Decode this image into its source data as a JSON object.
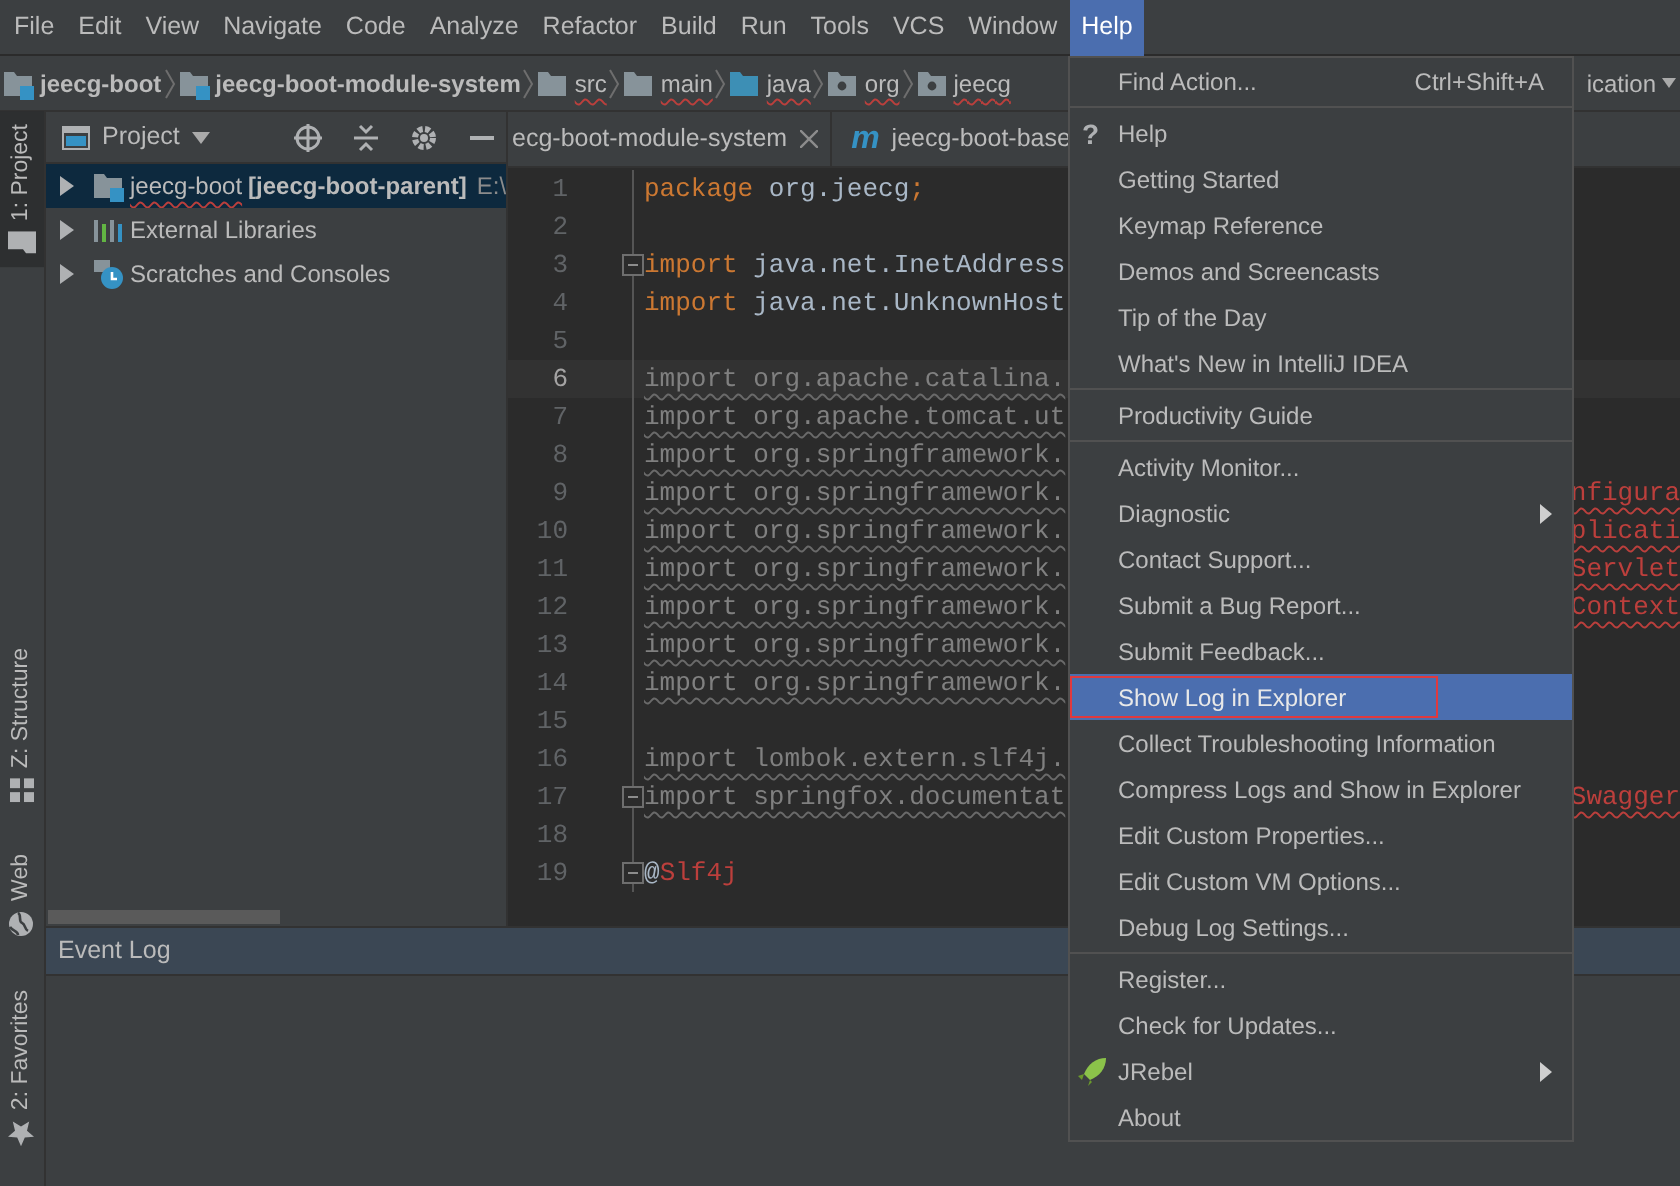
{
  "menu_bar": [
    {
      "label": "File",
      "selected": false
    },
    {
      "label": "Edit",
      "selected": false
    },
    {
      "label": "View",
      "selected": false
    },
    {
      "label": "Navigate",
      "selected": false
    },
    {
      "label": "Code",
      "selected": false
    },
    {
      "label": "Analyze",
      "selected": false
    },
    {
      "label": "Refactor",
      "selected": false
    },
    {
      "label": "Build",
      "selected": false
    },
    {
      "label": "Run",
      "selected": false
    },
    {
      "label": "Tools",
      "selected": false
    },
    {
      "label": "VCS",
      "selected": false
    },
    {
      "label": "Window",
      "selected": false
    },
    {
      "label": "Help",
      "selected": true
    }
  ],
  "breadcrumbs": [
    {
      "label": "jeecg-boot",
      "kind": "module",
      "misspelled": false
    },
    {
      "label": "jeecg-boot-module-system",
      "kind": "module",
      "misspelled": false
    },
    {
      "label": "src",
      "kind": "folder",
      "misspelled": true
    },
    {
      "label": "main",
      "kind": "folder",
      "misspelled": true
    },
    {
      "label": "java",
      "kind": "source",
      "misspelled": true
    },
    {
      "label": "org",
      "kind": "package",
      "misspelled": true
    },
    {
      "label": "jeecg",
      "kind": "package",
      "misspelled": true
    }
  ],
  "run_config": {
    "label": "ication"
  },
  "tool_strip": {
    "top": [
      {
        "label": "1: Project",
        "kind": "project",
        "selected": true
      }
    ],
    "bottom": [
      {
        "label": "Z: Structure",
        "kind": "structure",
        "selected": false
      },
      {
        "label": "Web",
        "kind": "web",
        "selected": false
      },
      {
        "label": "2: Favorites",
        "kind": "favorites",
        "selected": false
      }
    ]
  },
  "project_panel": {
    "title": "Project",
    "tree": [
      {
        "label": "jeecg-boot",
        "qualifier": "[jeecg-boot-parent]",
        "path": "E:\\",
        "kind": "module",
        "expanded": false,
        "selected": true
      },
      {
        "label": "External Libraries",
        "kind": "libraries",
        "expanded": false,
        "selected": false
      },
      {
        "label": "Scratches and Consoles",
        "kind": "scratches",
        "expanded": false,
        "selected": false
      }
    ]
  },
  "editor": {
    "tabs": [
      {
        "label": "ecg-boot-module-system",
        "kind": "file",
        "closable": true
      },
      {
        "label": "jeecg-boot-base",
        "kind": "maven",
        "glyph": "m",
        "closable": false
      }
    ],
    "lines": [
      {
        "number": "1",
        "current": false,
        "fold": false,
        "segments": [
          {
            "text": "package",
            "kind": "keyword"
          },
          {
            "text": " org.jeecg",
            "kind": "plain"
          },
          {
            "text": ";",
            "kind": "keyword"
          }
        ]
      },
      {
        "number": "2",
        "current": false,
        "fold": false
      },
      {
        "number": "3",
        "current": false,
        "fold": true,
        "segments": [
          {
            "text": "import",
            "kind": "keyword"
          },
          {
            "text": " java.net.InetAddress",
            "kind": "plain"
          }
        ]
      },
      {
        "number": "4",
        "current": false,
        "fold": false,
        "segments": [
          {
            "text": "import",
            "kind": "keyword"
          },
          {
            "text": " java.net.UnknownHost",
            "kind": "plain"
          }
        ]
      },
      {
        "number": "5",
        "current": false,
        "fold": false
      },
      {
        "number": "6",
        "current": true,
        "fold": false,
        "segments": [
          {
            "text": "import org.apache.catalina.",
            "kind": "unused"
          }
        ]
      },
      {
        "number": "7",
        "current": false,
        "fold": false,
        "segments": [
          {
            "text": "import org.apache.tomcat.ut",
            "kind": "unused"
          }
        ]
      },
      {
        "number": "8",
        "current": false,
        "fold": false,
        "segments": [
          {
            "text": "import org.springframework.",
            "kind": "unused"
          }
        ]
      },
      {
        "number": "9",
        "current": false,
        "fold": false,
        "segments": [
          {
            "text": "import org.springframework.",
            "kind": "unused"
          }
        ],
        "tail": "nfigura"
      },
      {
        "number": "10",
        "current": false,
        "fold": false,
        "segments": [
          {
            "text": "import org.springframework.",
            "kind": "unused"
          }
        ],
        "tail": "plicati"
      },
      {
        "number": "11",
        "current": false,
        "fold": false,
        "segments": [
          {
            "text": "import org.springframework.",
            "kind": "unused"
          }
        ],
        "tail": "Servlet"
      },
      {
        "number": "12",
        "current": false,
        "fold": false,
        "segments": [
          {
            "text": "import org.springframework.",
            "kind": "unused"
          }
        ],
        "tail": "Context"
      },
      {
        "number": "13",
        "current": false,
        "fold": false,
        "segments": [
          {
            "text": "import org.springframework.",
            "kind": "unused"
          }
        ]
      },
      {
        "number": "14",
        "current": false,
        "fold": false,
        "segments": [
          {
            "text": "import org.springframework.",
            "kind": "unused"
          }
        ]
      },
      {
        "number": "15",
        "current": false,
        "fold": false
      },
      {
        "number": "16",
        "current": false,
        "fold": false,
        "segments": [
          {
            "text": "import lombok.extern.slf4j.",
            "kind": "unused"
          }
        ]
      },
      {
        "number": "17",
        "current": false,
        "fold": true,
        "segments": [
          {
            "text": "import springfox.documentat",
            "kind": "unused"
          }
        ],
        "tail": "Swagger"
      },
      {
        "number": "18",
        "current": false,
        "fold": false
      },
      {
        "number": "19",
        "current": false,
        "fold": true,
        "segments": [
          {
            "text": "@",
            "kind": "plain"
          },
          {
            "text": "Slf4j",
            "kind": "annotation"
          }
        ]
      }
    ]
  },
  "event_log": {
    "title": "Event Log"
  },
  "help_menu": {
    "items": [
      {
        "kind": "item",
        "label": "Find Action...",
        "shortcut": "Ctrl+Shift+A",
        "selected": false
      },
      {
        "kind": "separator"
      },
      {
        "kind": "item",
        "label": "Help",
        "glyph": "?",
        "selected": false
      },
      {
        "kind": "item",
        "label": "Getting Started",
        "selected": false
      },
      {
        "kind": "item",
        "label": "Keymap Reference",
        "selected": false
      },
      {
        "kind": "item",
        "label": "Demos and Screencasts",
        "selected": false
      },
      {
        "kind": "item",
        "label": "Tip of the Day",
        "selected": false
      },
      {
        "kind": "item",
        "label": "What's New in IntelliJ IDEA",
        "selected": false
      },
      {
        "kind": "separator"
      },
      {
        "kind": "item",
        "label": "Productivity Guide",
        "selected": false
      },
      {
        "kind": "separator"
      },
      {
        "kind": "item",
        "label": "Activity Monitor...",
        "selected": false
      },
      {
        "kind": "item",
        "label": "Diagnostic",
        "submenu": true,
        "selected": false
      },
      {
        "kind": "item",
        "label": "Contact Support...",
        "selected": false
      },
      {
        "kind": "item",
        "label": "Submit a Bug Report...",
        "selected": false
      },
      {
        "kind": "item",
        "label": "Submit Feedback...",
        "selected": false
      },
      {
        "kind": "item",
        "label": "Show Log in Explorer",
        "selected": true,
        "marked": true
      },
      {
        "kind": "item",
        "label": "Collect Troubleshooting Information",
        "selected": false
      },
      {
        "kind": "item",
        "label": "Compress Logs and Show in Explorer",
        "selected": false
      },
      {
        "kind": "item",
        "label": "Edit Custom Properties...",
        "selected": false
      },
      {
        "kind": "item",
        "label": "Edit Custom VM Options...",
        "selected": false
      },
      {
        "kind": "item",
        "label": "Debug Log Settings...",
        "selected": false
      },
      {
        "kind": "separator"
      },
      {
        "kind": "item",
        "label": "Register...",
        "selected": false
      },
      {
        "kind": "item",
        "label": "Check for Updates...",
        "selected": false
      },
      {
        "kind": "item",
        "label": "JRebel",
        "plugin": true,
        "submenu": true,
        "selected": false
      },
      {
        "kind": "item",
        "label": "About",
        "selected": false
      }
    ]
  }
}
